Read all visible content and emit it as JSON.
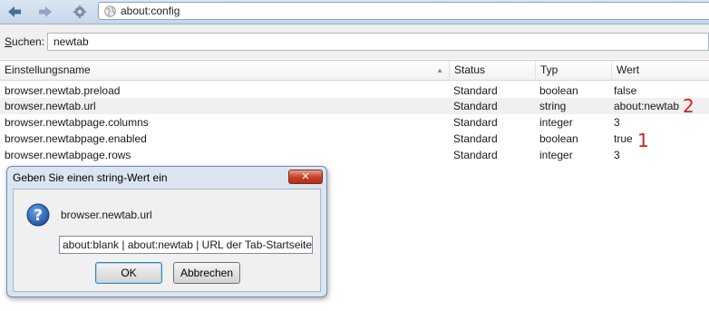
{
  "toolbar": {
    "url": "about:config"
  },
  "search": {
    "label_underlined": "S",
    "label_rest": "uchen:",
    "value": "newtab"
  },
  "table": {
    "headers": {
      "name": "Einstellungsname",
      "status": "Status",
      "typ": "Typ",
      "wert": "Wert"
    },
    "sorted_column": "name",
    "rows": [
      {
        "name": "browser.newtab.preload",
        "status": "Standard",
        "typ": "boolean",
        "wert": "false"
      },
      {
        "name": "browser.newtab.url",
        "status": "Standard",
        "typ": "string",
        "wert": "about:newtab"
      },
      {
        "name": "browser.newtabpage.columns",
        "status": "Standard",
        "typ": "integer",
        "wert": "3"
      },
      {
        "name": "browser.newtabpage.enabled",
        "status": "Standard",
        "typ": "boolean",
        "wert": "true"
      },
      {
        "name": "browser.newtabpage.rows",
        "status": "Standard",
        "typ": "integer",
        "wert": "3"
      }
    ]
  },
  "annotations": {
    "marker_1": "1",
    "marker_2": "2",
    "color": "#d42020"
  },
  "dialog": {
    "title": "Geben Sie einen string-Wert ein",
    "icon": "question-icon",
    "message": "browser.newtab.url",
    "input_value": "about:blank | about:newtab | URL der Tab-Startseite",
    "ok_label": "OK",
    "cancel_label": "Abbrechen"
  }
}
